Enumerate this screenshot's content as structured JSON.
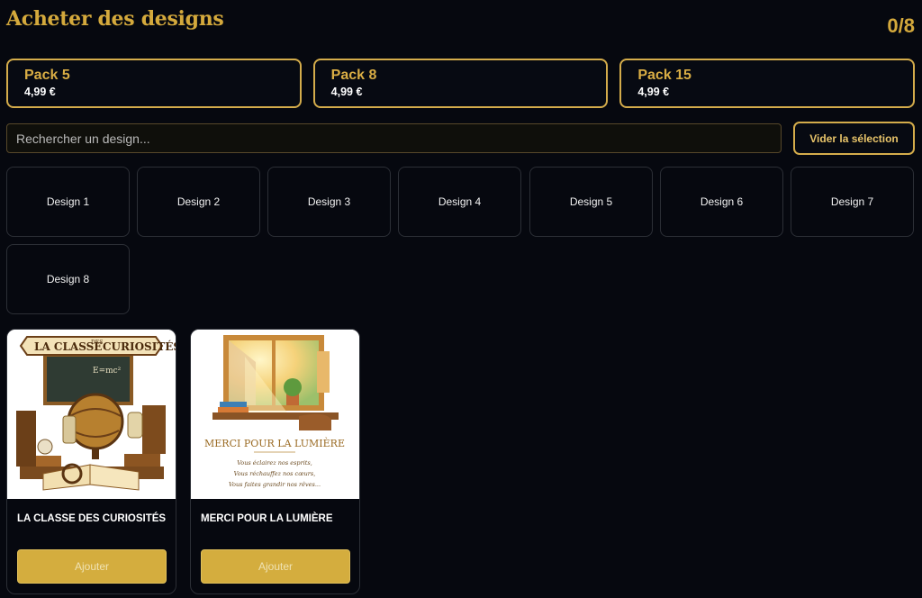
{
  "header": {
    "title": "Acheter des designs",
    "counter": "0/8"
  },
  "packs": [
    {
      "name": "Pack 5",
      "price": "4,99 €"
    },
    {
      "name": "Pack 8",
      "price": "4,99 €"
    },
    {
      "name": "Pack 15",
      "price": "4,99 €"
    }
  ],
  "search": {
    "placeholder": "Rechercher un design...",
    "value": "",
    "clear_label": "Vider la sélection"
  },
  "designs": [
    {
      "label": "Design 1"
    },
    {
      "label": "Design 2"
    },
    {
      "label": "Design 3"
    },
    {
      "label": "Design 4"
    },
    {
      "label": "Design 5"
    },
    {
      "label": "Design 6"
    },
    {
      "label": "Design 7"
    },
    {
      "label": "Design 8"
    }
  ],
  "products": [
    {
      "title": "LA CLASSE DES CURIOSITÉS",
      "add_label": "Ajouter",
      "art_banner_1": "LA CLASSE",
      "art_banner_small": "DES",
      "art_banner_2": "CURIOSITÉS",
      "art_board": "E=mc²"
    },
    {
      "title": "MERCI POUR LA LUMIÈRE",
      "add_label": "Ajouter",
      "art_heading": "MERCI POUR LA LUMIÈRE",
      "art_lines": [
        "Vous éclairez nos esprits,",
        "Vous réchauffez nos cœurs,",
        "Vous faites grandir nos rêves..."
      ]
    }
  ],
  "colors": {
    "background": "#06080f",
    "accent": "#d4a93c",
    "button": "#d4ad3e"
  }
}
